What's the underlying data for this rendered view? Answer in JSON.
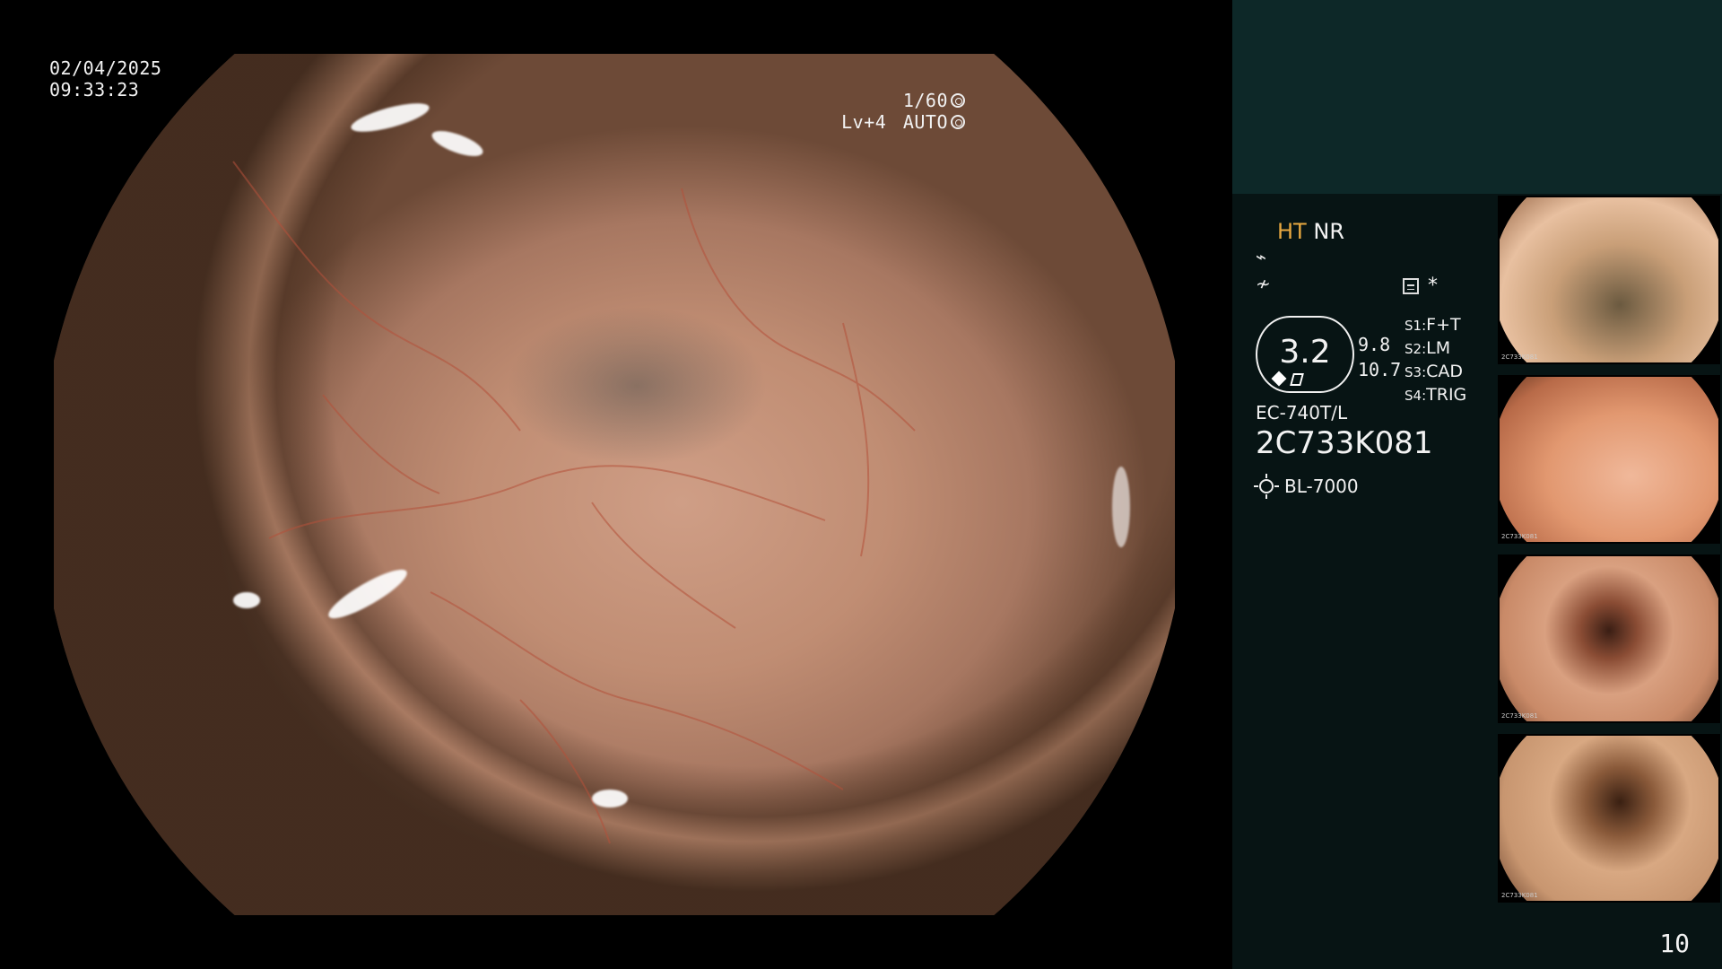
{
  "datetime": {
    "date": "02/04/2025",
    "time": "09:33:23"
  },
  "exposure": {
    "shutter": "1/60",
    "level": "Lv+4",
    "mode": "AUTO"
  },
  "panel": {
    "ht": "HT",
    "nr": "NR",
    "zoom": "3.2",
    "zoom_sub1": "9.8",
    "zoom_sub2": "10.7",
    "switches": [
      {
        "key": "S1",
        "value": "F+T"
      },
      {
        "key": "S2",
        "value": "LM"
      },
      {
        "key": "S3",
        "value": "CAD"
      },
      {
        "key": "S4",
        "value": "TRIG"
      }
    ],
    "scope_model": "EC-740T/L",
    "scope_serial": "2C733K081",
    "light_source": "BL-7000",
    "star": "*"
  },
  "thumbnails": [
    {
      "caption": "2C733K081"
    },
    {
      "caption": "2C733K081"
    },
    {
      "caption": "2C733K081"
    },
    {
      "caption": "2C733K081"
    }
  ],
  "page_number": "10",
  "icons": {
    "shutter": "aperture-icon",
    "auto": "auto-iris-icon",
    "light": "light-source-icon",
    "structure": "structure-enhance-icon",
    "color": "color-enhance-icon",
    "list": "record-list-icon"
  },
  "colors": {
    "panel_top": "#0d2828",
    "panel": "#071414",
    "ht_accent": "#e8a840"
  }
}
